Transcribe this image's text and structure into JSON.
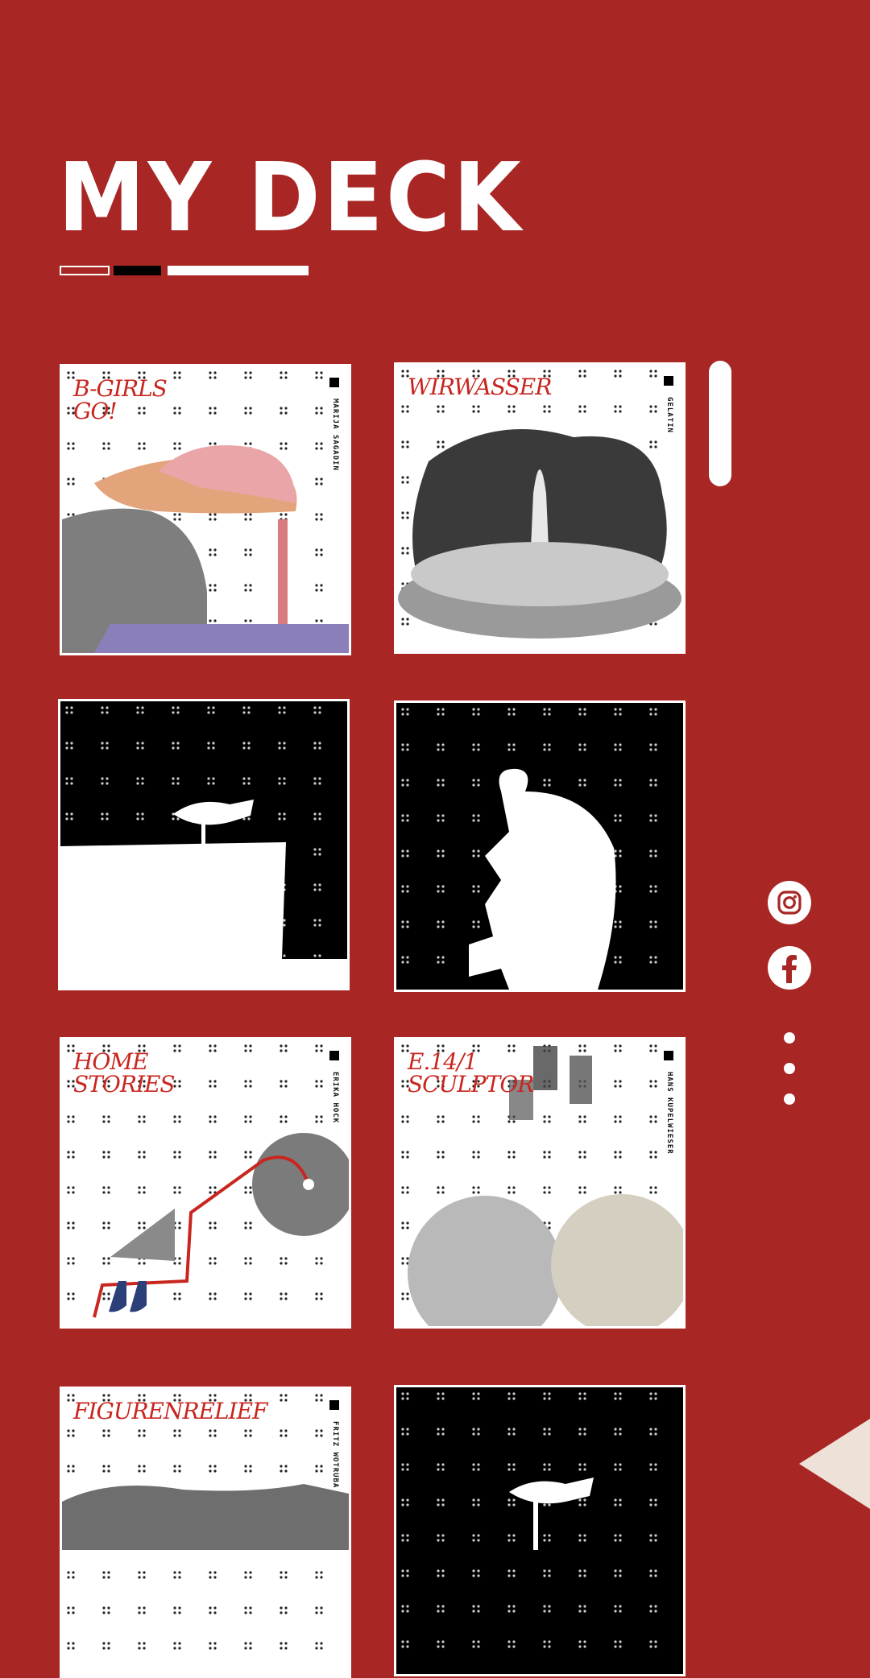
{
  "page": {
    "title": "MY DECK"
  },
  "colors": {
    "background": "#a82624",
    "accent_red": "#c8261f",
    "white": "#ffffff",
    "black": "#000000",
    "beige": "#eee1d8"
  },
  "cards": [
    {
      "title": "B-GIRLs\nGO!",
      "author": "MARIJA SAGADIN",
      "style": "light"
    },
    {
      "title": "WIRWASSER",
      "author": "GELATIN",
      "style": "light"
    },
    {
      "title": "",
      "author": "",
      "style": "dark"
    },
    {
      "title": "",
      "author": "",
      "style": "dark"
    },
    {
      "title": "HOME\nSTORIES",
      "author": "ERIKA HOCK",
      "style": "light"
    },
    {
      "title": "e.14/1\nSCULPTOR",
      "author": "HANS KUPELWIESER",
      "style": "light"
    },
    {
      "title": "FIGURENRELIEF",
      "author": "FRITZ WOTRUBA",
      "style": "light"
    },
    {
      "title": "",
      "author": "",
      "style": "dark"
    }
  ],
  "sidebar": {
    "icons": [
      "instagram-icon",
      "facebook-icon",
      "more-vertical-icon"
    ]
  }
}
